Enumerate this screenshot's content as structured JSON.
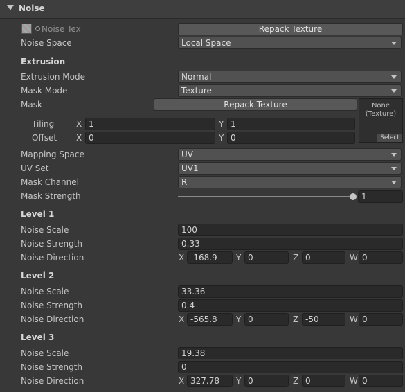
{
  "header": {
    "title": "Noise"
  },
  "noise_tex": {
    "label": "Noise Tex",
    "button": "Repack Texture"
  },
  "noise_space": {
    "label": "Noise Space",
    "value": "Local Space"
  },
  "extrusion": {
    "heading": "Extrusion",
    "mode": {
      "label": "Extrusion Mode",
      "value": "Normal"
    },
    "mask_mode": {
      "label": "Mask Mode",
      "value": "Texture"
    },
    "mask": {
      "label": "Mask",
      "button": "Repack Texture",
      "tex_none": "None",
      "tex_type": "(Texture)",
      "select": "Select"
    },
    "tiling": {
      "label": "Tiling",
      "x_axis": "X",
      "x": "1",
      "y_axis": "Y",
      "y": "1"
    },
    "offset": {
      "label": "Offset",
      "x_axis": "X",
      "x": "0",
      "y_axis": "Y",
      "y": "0"
    },
    "mapping_space": {
      "label": "Mapping Space",
      "value": "UV"
    },
    "uv_set": {
      "label": "UV Set",
      "value": "UV1"
    },
    "mask_channel": {
      "label": "Mask Channel",
      "value": "R"
    },
    "mask_strength": {
      "label": "Mask Strength",
      "value": "1",
      "fraction": 1.0
    }
  },
  "levels": [
    {
      "heading": "Level 1",
      "scale_label": "Noise Scale",
      "scale": "100",
      "strength_label": "Noise Strength",
      "strength": "0.33",
      "dir_label": "Noise Direction",
      "x": "-168.9",
      "y": "0",
      "z": "0",
      "w": "0"
    },
    {
      "heading": "Level 2",
      "scale_label": "Noise Scale",
      "scale": "33.36",
      "strength_label": "Noise Strength",
      "strength": "0.4",
      "dir_label": "Noise Direction",
      "x": "-565.8",
      "y": "0",
      "z": "-50",
      "w": "0"
    },
    {
      "heading": "Level 3",
      "scale_label": "Noise Scale",
      "scale": "19.38",
      "strength_label": "Noise Strength",
      "strength": "0",
      "dir_label": "Noise Direction",
      "x": "327.78",
      "y": "0",
      "z": "0",
      "w": "0"
    }
  ],
  "axes": {
    "x": "X",
    "y": "Y",
    "z": "Z",
    "w": "W"
  }
}
